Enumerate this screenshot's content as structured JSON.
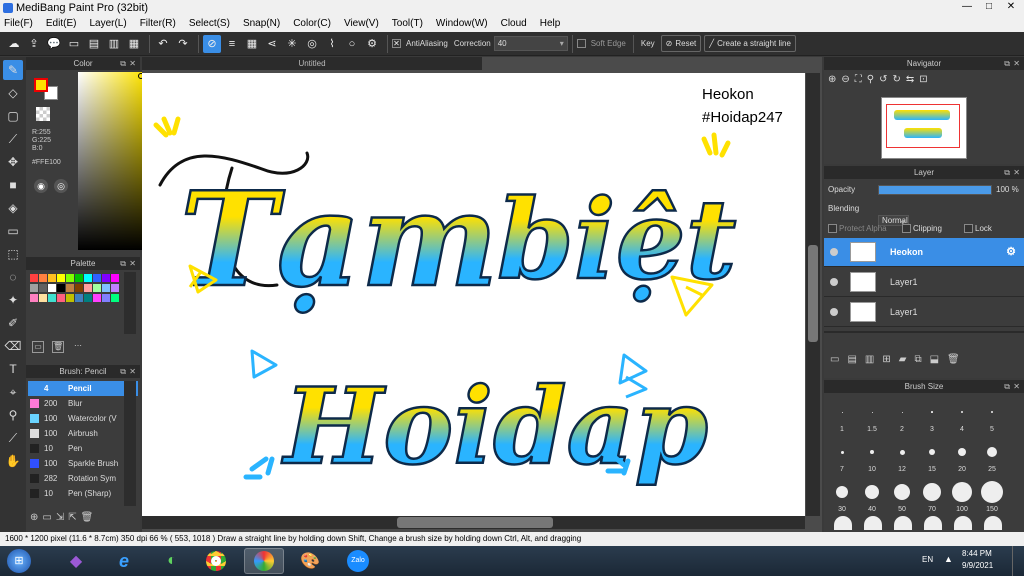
{
  "window": {
    "title": "MediBang Paint Pro (32bit)",
    "controls": [
      "—",
      "□",
      "✕"
    ]
  },
  "menu": [
    "File(F)",
    "Edit(E)",
    "Layer(L)",
    "Filter(R)",
    "Select(S)",
    "Snap(N)",
    "Color(C)",
    "View(V)",
    "Tool(T)",
    "Window(W)",
    "Cloud",
    "Help"
  ],
  "toolbar": {
    "antialiasing_label": "AntiAliasing",
    "correction_label": "Correction",
    "correction_value": "40",
    "soft_edge_label": "Soft Edge",
    "key_label": "Key",
    "reset_label": "Reset",
    "straight_line_label": "Create a straight line"
  },
  "color_panel": {
    "title": "Color",
    "r": "R:255",
    "g": "G:225",
    "b": "B:0",
    "hex": "#FFE100",
    "primary": "#FFE100",
    "secondary": "#FFFFFF"
  },
  "palette_panel": {
    "title": "Palette",
    "colors": [
      "#ff4040",
      "#ff8040",
      "#ffc020",
      "#ffff00",
      "#80ff00",
      "#00c000",
      "#00ffff",
      "#3060ff",
      "#8000ff",
      "#ff00ff",
      "#a0a0a0",
      "#606060",
      "#ffffff",
      "#000000",
      "#c08040",
      "#804000",
      "#ffa0a0",
      "#a0ffa0",
      "#80c0ff",
      "#c080ff",
      "#ff80c0",
      "#ffe0a0",
      "#40e0d0",
      "#ff6080",
      "#c0c000",
      "#4080c0",
      "#008080",
      "#ff40ff",
      "#8080ff",
      "#00ff80"
    ]
  },
  "brush_panel": {
    "title": "Brush: Pencil",
    "items": [
      {
        "size": "4",
        "name": "Pencil",
        "color": "#3a8ee6"
      },
      {
        "size": "200",
        "name": "Blur",
        "color": "#ff7ad6"
      },
      {
        "size": "100",
        "name": "Watercolor (V",
        "color": "#6ad4ff"
      },
      {
        "size": "100",
        "name": "Airbrush",
        "color": "#dddddd"
      },
      {
        "size": "10",
        "name": "Pen",
        "color": "#222222"
      },
      {
        "size": "100",
        "name": "Sparkle Brush",
        "color": "#3050ff"
      },
      {
        "size": "282",
        "name": "Rotation Sym",
        "color": "#222222"
      },
      {
        "size": "10",
        "name": "Pen (Sharp)",
        "color": "#222222"
      }
    ]
  },
  "canvas": {
    "tab_title": "Untitled",
    "watermark_line1": "Heokon",
    "watermark_line2": "#Hoidap247",
    "word1": "Tạm",
    "word2": "biệt",
    "word3": "Hoidap"
  },
  "navigator": {
    "title": "Navigator"
  },
  "layer_panel": {
    "title": "Layer",
    "opacity_label": "Opacity",
    "opacity_value": "100 %",
    "opacity_fraction": 1.0,
    "blending_label": "Blending",
    "blending_value": "Normal",
    "protect_alpha": "Protect Alpha",
    "clipping": "Clipping",
    "lock": "Lock",
    "layers": [
      {
        "name": "Heokon",
        "selected": true
      },
      {
        "name": "Layer1",
        "selected": false
      },
      {
        "name": "Layer1",
        "selected": false
      }
    ]
  },
  "brush_size_panel": {
    "title": "Brush Size",
    "sizes": [
      "1",
      "1.5",
      "2",
      "3",
      "4",
      "5",
      "7",
      "10",
      "12",
      "15",
      "20",
      "25",
      "30",
      "40",
      "50",
      "70",
      "100",
      "150"
    ]
  },
  "status": {
    "text": "1600 * 1200 pixel   (11.6 * 8.7cm)   350 dpi   66 %   ( 553, 1018 )   Draw a straight line by holding down Shift, Change a brush size by holding down Ctrl, Alt, and dragging"
  },
  "taskbar": {
    "lang": "EN",
    "time": "8:44 PM",
    "date": "9/9/2021"
  }
}
